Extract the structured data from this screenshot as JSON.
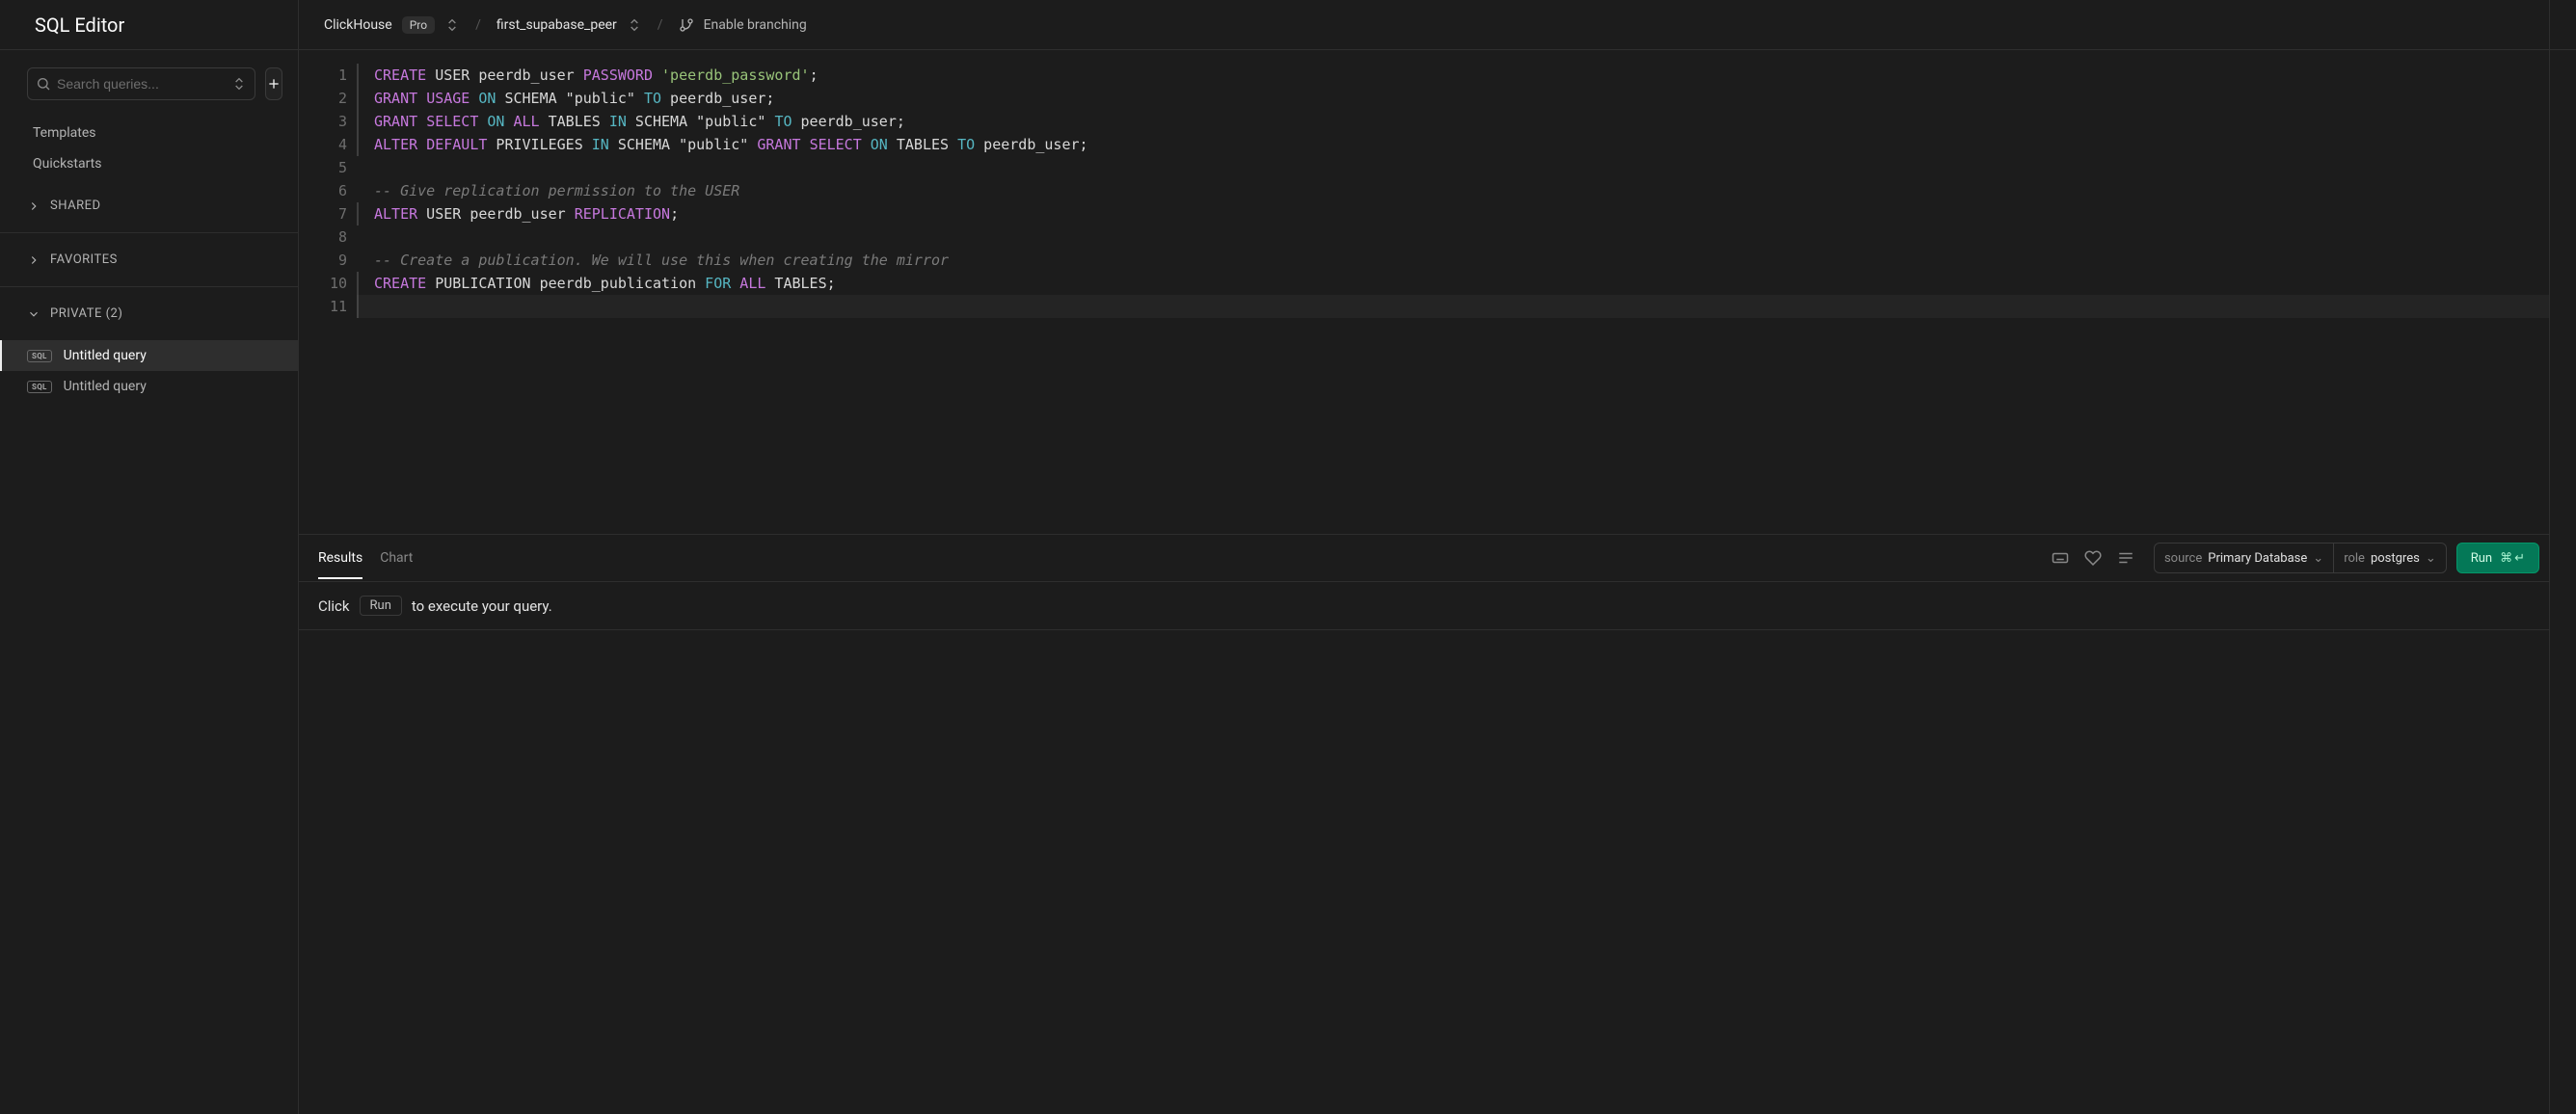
{
  "app_title": "SQL Editor",
  "search_placeholder": "Search queries...",
  "nav": {
    "templates": "Templates",
    "quickstarts": "Quickstarts"
  },
  "sections": {
    "shared": "SHARED",
    "favorites": "FAVORITES",
    "private": "PRIVATE (2)"
  },
  "queries": [
    {
      "label": "Untitled query",
      "active": true
    },
    {
      "label": "Untitled query",
      "active": false
    }
  ],
  "breadcrumb": {
    "org": "ClickHouse",
    "badge": "Pro",
    "project": "first_supabase_peer",
    "branching": "Enable branching"
  },
  "editor": {
    "line_count": 11,
    "tokens": [
      [
        {
          "t": "kw",
          "v": "CREATE"
        },
        {
          "t": "ident",
          "v": " USER peerdb_user "
        },
        {
          "t": "kw",
          "v": "PASSWORD"
        },
        {
          "t": "ident",
          "v": " "
        },
        {
          "t": "str",
          "v": "'peerdb_password'"
        },
        {
          "t": "ident",
          "v": ";"
        }
      ],
      [
        {
          "t": "kw",
          "v": "GRANT"
        },
        {
          "t": "ident",
          "v": " "
        },
        {
          "t": "kw",
          "v": "USAGE"
        },
        {
          "t": "ident",
          "v": " "
        },
        {
          "t": "kw2",
          "v": "ON"
        },
        {
          "t": "ident",
          "v": " SCHEMA \"public\" "
        },
        {
          "t": "kw2",
          "v": "TO"
        },
        {
          "t": "ident",
          "v": " peerdb_user;"
        }
      ],
      [
        {
          "t": "kw",
          "v": "GRANT"
        },
        {
          "t": "ident",
          "v": " "
        },
        {
          "t": "kw",
          "v": "SELECT"
        },
        {
          "t": "ident",
          "v": " "
        },
        {
          "t": "kw2",
          "v": "ON"
        },
        {
          "t": "ident",
          "v": " "
        },
        {
          "t": "kw",
          "v": "ALL"
        },
        {
          "t": "ident",
          "v": " TABLES "
        },
        {
          "t": "kw2",
          "v": "IN"
        },
        {
          "t": "ident",
          "v": " SCHEMA \"public\" "
        },
        {
          "t": "kw2",
          "v": "TO"
        },
        {
          "t": "ident",
          "v": " peerdb_user;"
        }
      ],
      [
        {
          "t": "kw",
          "v": "ALTER"
        },
        {
          "t": "ident",
          "v": " "
        },
        {
          "t": "kw",
          "v": "DEFAULT"
        },
        {
          "t": "ident",
          "v": " PRIVILEGES "
        },
        {
          "t": "kw2",
          "v": "IN"
        },
        {
          "t": "ident",
          "v": " SCHEMA \"public\" "
        },
        {
          "t": "kw",
          "v": "GRANT"
        },
        {
          "t": "ident",
          "v": " "
        },
        {
          "t": "kw",
          "v": "SELECT"
        },
        {
          "t": "ident",
          "v": " "
        },
        {
          "t": "kw2",
          "v": "ON"
        },
        {
          "t": "ident",
          "v": " TABLES "
        },
        {
          "t": "kw2",
          "v": "TO"
        },
        {
          "t": "ident",
          "v": " peerdb_user;"
        }
      ],
      [],
      [
        {
          "t": "cmt",
          "v": "-- Give replication permission to the USER"
        }
      ],
      [
        {
          "t": "kw",
          "v": "ALTER"
        },
        {
          "t": "ident",
          "v": " USER peerdb_user "
        },
        {
          "t": "kw",
          "v": "REPLICATION"
        },
        {
          "t": "ident",
          "v": ";"
        }
      ],
      [],
      [
        {
          "t": "cmt",
          "v": "-- Create a publication. We will use this when creating the mirror"
        }
      ],
      [
        {
          "t": "kw",
          "v": "CREATE"
        },
        {
          "t": "ident",
          "v": " PUBLICATION peerdb_publication "
        },
        {
          "t": "kw2",
          "v": "FOR"
        },
        {
          "t": "ident",
          "v": " "
        },
        {
          "t": "kw",
          "v": "ALL"
        },
        {
          "t": "ident",
          "v": " TABLES;"
        }
      ],
      []
    ],
    "cursor_line": 11,
    "bordered_lines": [
      1,
      2,
      3,
      4,
      7,
      10
    ]
  },
  "results_tabs": {
    "results": "Results",
    "chart": "Chart",
    "active": "results"
  },
  "source_selector": {
    "label": "source",
    "value": "Primary Database"
  },
  "role_selector": {
    "label": "role",
    "value": "postgres"
  },
  "run_button": {
    "label": "Run",
    "shortcut_cmd": "⌘",
    "shortcut_enter": "↵"
  },
  "results_hint": {
    "prefix": "Click",
    "key": "Run",
    "suffix": "to execute your query."
  }
}
